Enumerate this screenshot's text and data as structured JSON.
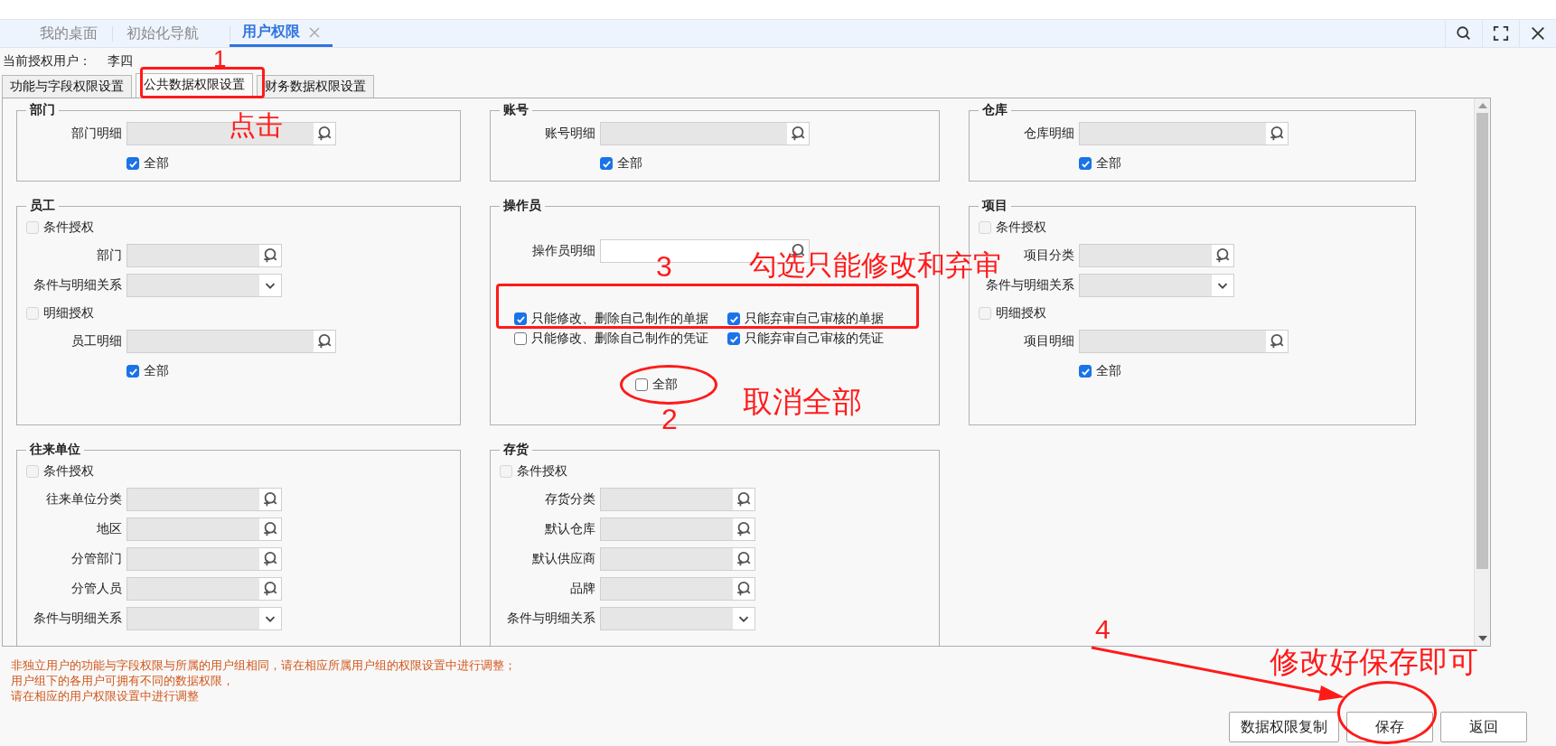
{
  "tabs": [
    {
      "label": "我的桌面",
      "selected": false,
      "closable": false
    },
    {
      "label": "初始化导航",
      "selected": false,
      "closable": false
    },
    {
      "label": "用户权限",
      "selected": true,
      "closable": true
    }
  ],
  "current_user": {
    "label": "当前授权用户：",
    "value": "李四"
  },
  "sub_tabs": [
    {
      "label": "功能与字段权限设置",
      "selected": false
    },
    {
      "label": "公共数据权限设置",
      "selected": true
    },
    {
      "label": "财务数据权限设置",
      "selected": false
    }
  ],
  "groups": [
    {
      "title": "部门",
      "rows": [
        {
          "kind": "detail",
          "label": "部门明细",
          "disabled": true
        },
        {
          "kind": "all",
          "label": "全部",
          "checked": true
        }
      ]
    },
    {
      "title": "账号",
      "rows": [
        {
          "kind": "detail",
          "label": "账号明细",
          "disabled": true
        },
        {
          "kind": "all",
          "label": "全部",
          "checked": true
        }
      ]
    },
    {
      "title": "仓库",
      "rows": [
        {
          "kind": "detail",
          "label": "仓库明细",
          "disabled": true
        },
        {
          "kind": "all",
          "label": "全部",
          "checked": true
        }
      ]
    },
    {
      "title": "员工",
      "rows": [
        {
          "kind": "check",
          "label": "条件授权",
          "checked": false,
          "disabled": true
        },
        {
          "kind": "lookup",
          "label": "部门",
          "disabled": true
        },
        {
          "kind": "select",
          "label": "条件与明细关系",
          "disabled": true
        },
        {
          "kind": "check",
          "label": "明细授权",
          "checked": false,
          "disabled": true
        },
        {
          "kind": "detail",
          "label": "员工明细",
          "disabled": true
        },
        {
          "kind": "all",
          "label": "全部",
          "checked": true
        }
      ]
    },
    {
      "title": "操作员",
      "rows": [
        {
          "kind": "detail",
          "label": "操作员明细",
          "disabled": false
        },
        {
          "kind": "options",
          "items": [
            {
              "label": "只能修改、删除自己制作的单据",
              "checked": true
            },
            {
              "label": "只能弃审自己审核的单据",
              "checked": true
            },
            {
              "label": "只能修改、删除自己制作的凭证",
              "checked": false
            },
            {
              "label": "只能弃审自己审核的凭证",
              "checked": true
            }
          ]
        },
        {
          "kind": "center_all",
          "label": "全部",
          "checked": false
        }
      ]
    },
    {
      "title": "项目",
      "rows": [
        {
          "kind": "check",
          "label": "条件授权",
          "checked": false,
          "disabled": true
        },
        {
          "kind": "lookup",
          "label": "项目分类",
          "disabled": true
        },
        {
          "kind": "select",
          "label": "条件与明细关系",
          "disabled": true
        },
        {
          "kind": "check",
          "label": "明细授权",
          "checked": false,
          "disabled": true
        },
        {
          "kind": "detail",
          "label": "项目明细",
          "disabled": true
        },
        {
          "kind": "all",
          "label": "全部",
          "checked": true
        }
      ]
    },
    {
      "title": "往来单位",
      "rows": [
        {
          "kind": "check",
          "label": "条件授权",
          "checked": false,
          "disabled": true
        },
        {
          "kind": "lookup",
          "label": "往来单位分类",
          "disabled": true
        },
        {
          "kind": "lookup",
          "label": "地区",
          "disabled": true
        },
        {
          "kind": "lookup",
          "label": "分管部门",
          "disabled": true
        },
        {
          "kind": "lookup",
          "label": "分管人员",
          "disabled": true
        },
        {
          "kind": "select",
          "label": "条件与明细关系",
          "disabled": true
        }
      ]
    },
    {
      "title": "存货",
      "rows": [
        {
          "kind": "check",
          "label": "条件授权",
          "checked": false,
          "disabled": true
        },
        {
          "kind": "lookup",
          "label": "存货分类",
          "disabled": true
        },
        {
          "kind": "lookup",
          "label": "默认仓库",
          "disabled": true
        },
        {
          "kind": "lookup",
          "label": "默认供应商",
          "disabled": true
        },
        {
          "kind": "lookup",
          "label": "品牌",
          "disabled": true
        },
        {
          "kind": "select",
          "label": "条件与明细关系",
          "disabled": true
        }
      ]
    }
  ],
  "notes": [
    "非独立用户的功能与字段权限与所属的用户组相同，请在相应所属用户组的权限设置中进行调整；",
    "用户组下的各用户可拥有不同的数据权限，",
    "请在相应的用户权限设置中进行调整"
  ],
  "buttons": [
    "数据权限复制",
    "保存",
    "返回"
  ],
  "annotations": [
    "1",
    "点击",
    "3",
    "勾选只能修改和弃审",
    "2",
    "取消全部",
    "4",
    "修改好保存即可"
  ]
}
